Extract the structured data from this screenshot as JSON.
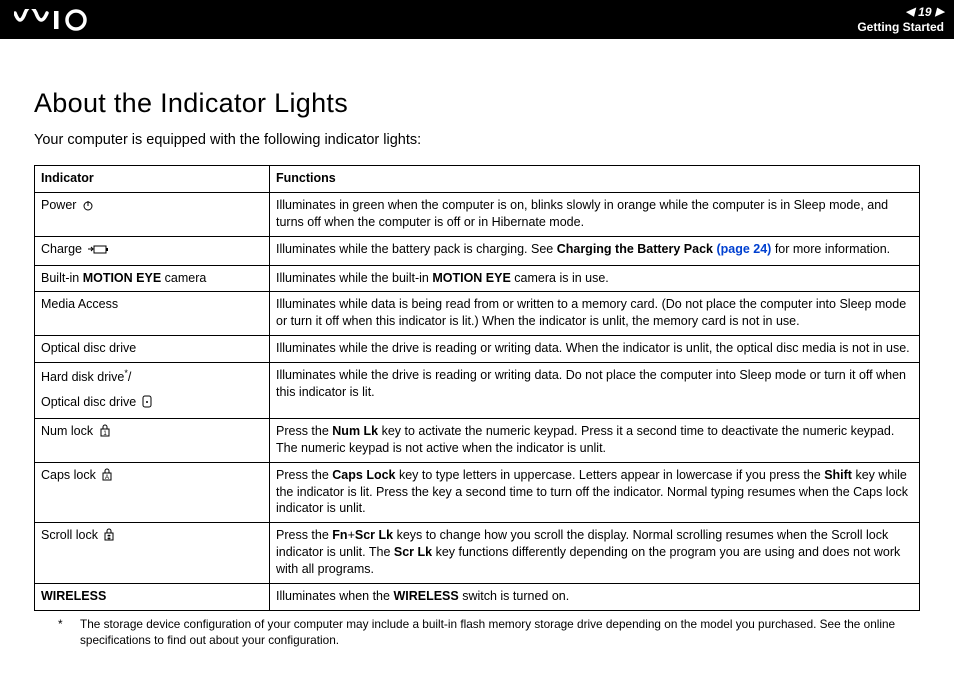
{
  "header": {
    "page_number": "19",
    "breadcrumb": "Getting Started"
  },
  "title": "About the Indicator Lights",
  "intro": "Your computer is equipped with the following indicator lights:",
  "table": {
    "headers": {
      "indicator": "Indicator",
      "functions": "Functions"
    },
    "rows": [
      {
        "indicator_pre": "Power ",
        "icon": "power-icon",
        "indicator_post": "",
        "functions": "Illuminates in green when the computer is on, blinks slowly in orange while the computer is in Sleep mode, and turns off when the computer is off or in Hibernate mode."
      },
      {
        "indicator_pre": "Charge ",
        "icon": "charge-icon",
        "indicator_post": "",
        "functions_pre": "Illuminates while the battery pack is charging. See ",
        "functions_bold": "Charging the Battery Pack ",
        "functions_link": "(page 24)",
        "functions_post": " for more information."
      },
      {
        "indicator_pre": "Built-in ",
        "indicator_bold": "MOTION EYE",
        "indicator_post": " camera",
        "functions_pre": "Illuminates while the built-in ",
        "functions_bold": "MOTION EYE",
        "functions_post": " camera is in use."
      },
      {
        "indicator_pre": "Media Access",
        "functions": "Illuminates while data is being read from or written to a memory card. (Do not place the computer into Sleep mode or turn it off when this indicator is lit.) When the indicator is unlit, the memory card is not in use."
      },
      {
        "indicator_pre": "Optical disc drive",
        "functions": "Illuminates while the drive is reading or writing data. When the indicator is unlit, the optical disc media is not in use."
      },
      {
        "indicator_line1_pre": "Hard disk drive",
        "indicator_line1_sup": "*",
        "indicator_line1_post": "/",
        "indicator_line2_pre": "Optical disc drive ",
        "icon": "disc-icon",
        "functions": "Illuminates while the drive is reading or writing data. Do not place the computer into Sleep mode or turn it off when this indicator is lit."
      },
      {
        "indicator_pre": "Num lock ",
        "icon": "numlock-icon",
        "functions_pre": "Press the ",
        "functions_bold": "Num Lk",
        "functions_post": " key to activate the numeric keypad. Press it a second time to deactivate the numeric keypad. The numeric keypad is not active when the indicator is unlit."
      },
      {
        "indicator_pre": "Caps lock ",
        "icon": "capslock-icon",
        "functions_pre": "Press the ",
        "functions_bold": "Caps Lock",
        "functions_mid": " key to type letters in uppercase. Letters appear in lowercase if you press the ",
        "functions_bold2": "Shift",
        "functions_post": " key while the indicator is lit. Press the key a second time to turn off the indicator. Normal typing resumes when the Caps lock indicator is unlit."
      },
      {
        "indicator_pre": "Scroll lock ",
        "icon": "scrolllock-icon",
        "functions_pre": "Press the ",
        "functions_bold": "Fn",
        "functions_mid": "+",
        "functions_bold2": "Scr Lk",
        "functions_mid2": " keys to change how you scroll the display. Normal scrolling resumes when the Scroll lock indicator is unlit. The ",
        "functions_bold3": "Scr Lk",
        "functions_post": " key functions differently depending on the program you are using and does not work with all programs."
      },
      {
        "indicator_bold": "WIRELESS",
        "functions_pre": "Illuminates when the ",
        "functions_bold": "WIRELESS",
        "functions_post": " switch is turned on."
      }
    ]
  },
  "footnote": {
    "star": "*",
    "text": "The storage device configuration of your computer may include a built-in flash memory storage drive depending on the model you purchased. See the online specifications to find out about your configuration."
  }
}
